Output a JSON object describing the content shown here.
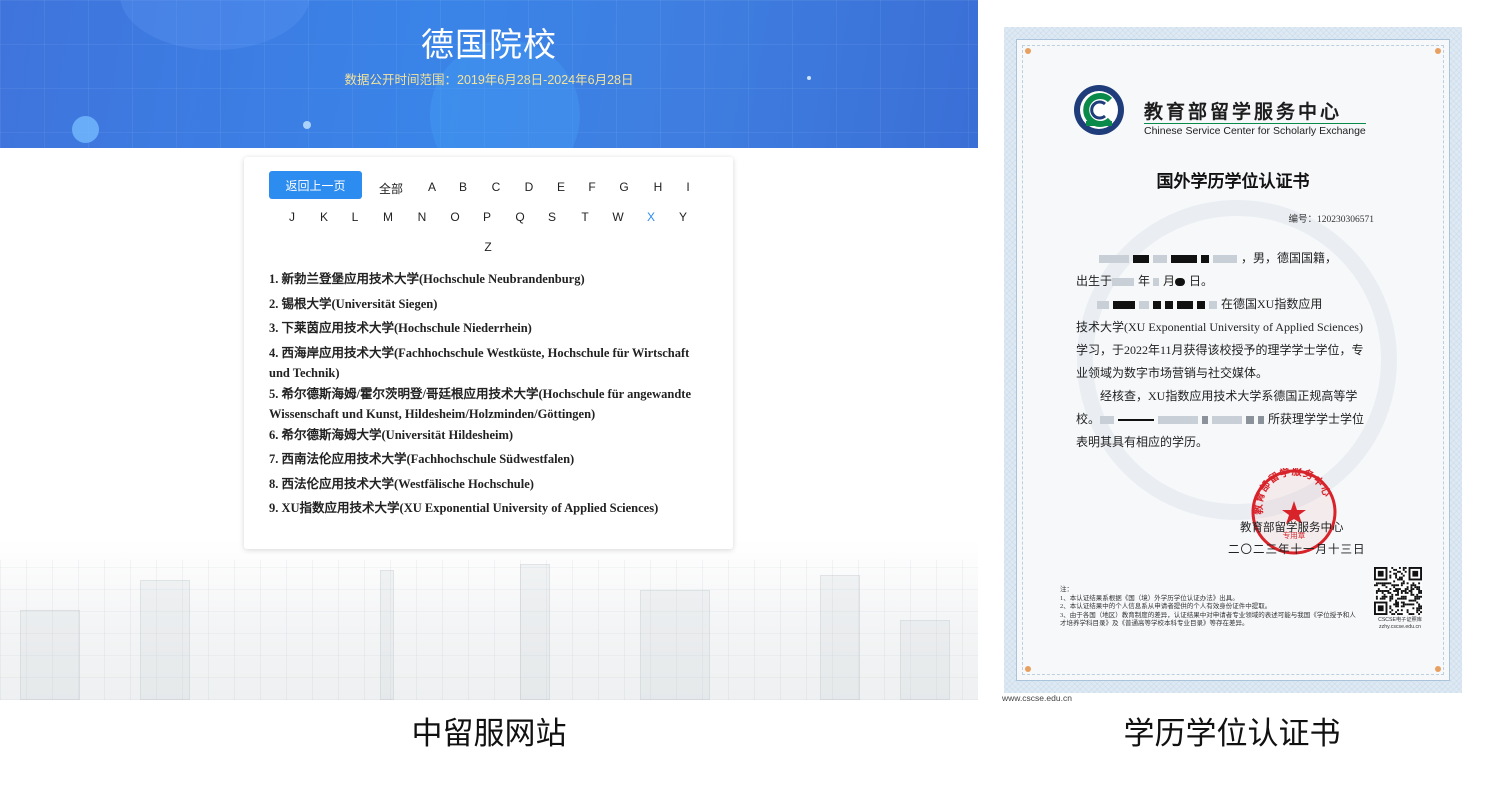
{
  "site": {
    "banner": {
      "title": "德国院校",
      "date_range": "数据公开时间范围：2019年6月28日-2024年6月28日"
    },
    "back_button": "返回上一页",
    "letters": [
      "全部",
      "A",
      "B",
      "C",
      "D",
      "E",
      "F",
      "G",
      "H",
      "I",
      "J",
      "K",
      "L",
      "M",
      "N",
      "O",
      "P",
      "Q",
      "S",
      "T",
      "W",
      "X",
      "Y",
      "Z"
    ],
    "active_letter": "X",
    "universities": [
      "1. 新勃兰登堡应用技术大学(Hochschule Neubrandenburg)",
      "2. 锡根大学(Universität Siegen)",
      "3. 下莱茵应用技术大学(Hochschule Niederrhein)",
      "4. 西海岸应用技术大学(Fachhochschule Westküste, Hochschule für Wirtschaft und Technik)",
      "5. 希尔德斯海姆/霍尔茨明登/哥廷根应用技术大学(Hochschule für angewandte Wissenschaft und Kunst, Hildesheim/Holzminden/Göttingen)",
      "6. 希尔德斯海姆大学(Universität Hildesheim)",
      "7. 西南法伦应用技术大学(Fachhochschule Südwestfalen)",
      "8. 西法伦应用技术大学(Westfälische Hochschule)",
      "9. XU指数应用技术大学(XU Exponential University of Applied Sciences)"
    ]
  },
  "certificate": {
    "org_name_cn": "教育部留学服务中心",
    "org_name_en": "Chinese Service Center for Scholarly Exchange",
    "title": "国外学历学位认证书",
    "number": "编号：120230306571",
    "line1_tail": "，男，德国国籍，",
    "line2": "出生于",
    "line2_year": "年",
    "line2_month": "月",
    "line2_day": "日。",
    "line3_tail": "在德国XU指数应用",
    "line4": "技术大学(XU Exponential University of Applied Sciences)",
    "line5": "学习，于2022年11月获得该校授予的理学学士学位，专",
    "line6": "业领域为数字市场营销与社交媒体。",
    "line7": "经核查，XU指数应用技术大学系德国正规高等学",
    "line8_head": "校。",
    "line8_tail": "所获理学学士学位",
    "line9": "表明其具有相应的学历。",
    "seal_org": "教育部留学服务中心",
    "seal_date": "二〇二三年十一月十三日",
    "seal_ring_text": "教育部留学服务中心",
    "seal_inner_text": "专用章",
    "notes": [
      "注：",
      "1、本认证结果系根据《国（境）外学历学位认证办法》出具。",
      "2、本认证结果中的个人信息系从申请者提供的个人有效身份证件中提取。",
      "3、由于各国（地区）教育制度的差异，认证结果中对申请者专业领域的表述可能与我国《学位授予和人才培养学科目录》及《普通高等学校本科专业目录》等存在差异。"
    ],
    "qr_label": "CSCSE电子证照库 zzhy.cscse.edu.cn",
    "url": "www.cscse.edu.cn"
  },
  "captions": {
    "left": "中留服网站",
    "right": "学历学位认证书"
  },
  "colors": {
    "banner_blue": "#3a7fe3",
    "button_blue": "#2d8cf0",
    "active_letter": "#2d8cf0",
    "date_range_text": "#f4e39a",
    "seal_red": "#d8232a",
    "logo_green": "#0a8a4a"
  }
}
